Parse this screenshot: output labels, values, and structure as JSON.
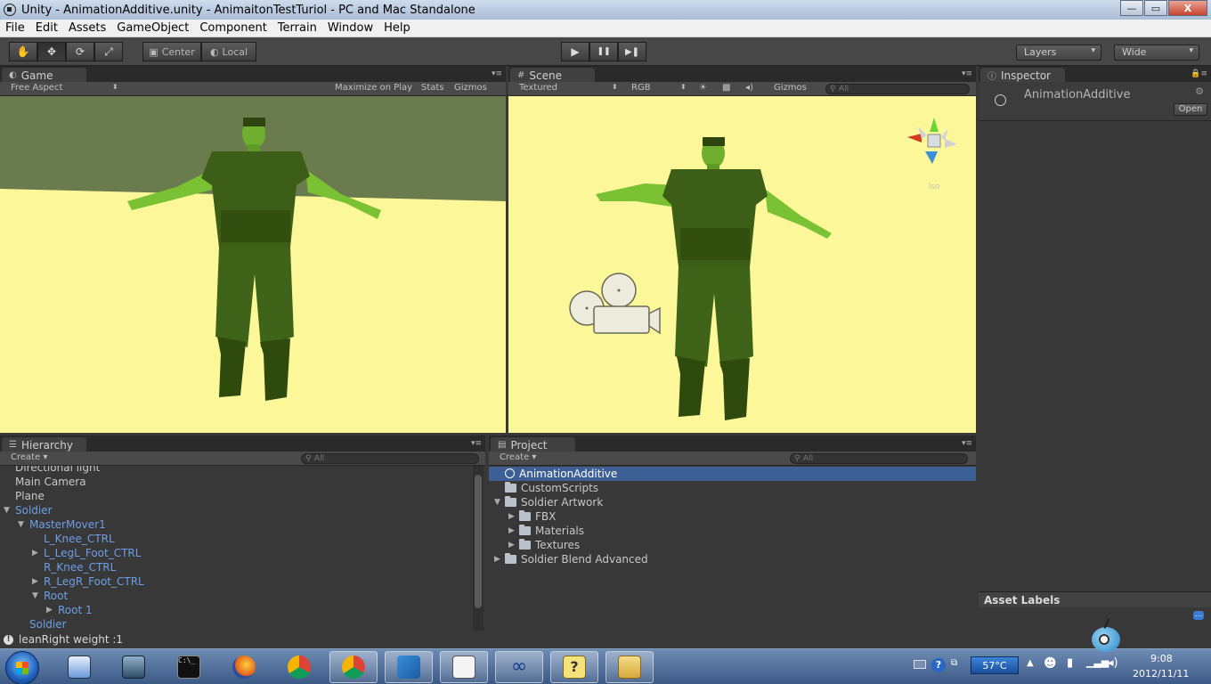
{
  "window": {
    "title": "Unity - AnimationAdditive.unity - AnimaitonTestTuriol - PC and Mac Standalone",
    "controls": {
      "minimize": "—",
      "maximize": "▭",
      "close": "X"
    }
  },
  "menu": [
    "File",
    "Edit",
    "Assets",
    "GameObject",
    "Component",
    "Terrain",
    "Window",
    "Help"
  ],
  "toolbar": {
    "tools": [
      "hand-icon",
      "move-icon",
      "rotate-icon",
      "scale-icon"
    ],
    "pivot_mode": "Center",
    "pivot_rotation": "Local",
    "play": "▶",
    "pause": "❚❚",
    "step": "▶❚",
    "layers": "Layers",
    "layout": "Wide"
  },
  "game": {
    "tab": "Game",
    "aspect": "Free Aspect",
    "maximize": "Maximize on Play",
    "stats": "Stats",
    "gizmos": "Gizmos"
  },
  "scene": {
    "tab": "Scene",
    "render_mode": "Textured",
    "channel": "RGB",
    "gizmos": "Gizmos",
    "search_placeholder": "All",
    "gizmo_label": "Iso"
  },
  "inspector": {
    "tab": "Inspector",
    "asset_name": "AnimationAdditive",
    "open_button": "Open",
    "asset_labels": "Asset Labels"
  },
  "hierarchy": {
    "tab": "Hierarchy",
    "create": "Create",
    "search_placeholder": "All",
    "items": [
      {
        "label": "Directional light",
        "indent": 0,
        "blue": false,
        "arrow": ""
      },
      {
        "label": "Main Camera",
        "indent": 0,
        "blue": false,
        "arrow": ""
      },
      {
        "label": "Plane",
        "indent": 0,
        "blue": false,
        "arrow": ""
      },
      {
        "label": "Soldier",
        "indent": 0,
        "blue": true,
        "arrow": "▼"
      },
      {
        "label": "MasterMover1",
        "indent": 1,
        "blue": true,
        "arrow": "▼"
      },
      {
        "label": "L_Knee_CTRL",
        "indent": 2,
        "blue": true,
        "arrow": ""
      },
      {
        "label": "L_LegL_Foot_CTRL",
        "indent": 2,
        "blue": true,
        "arrow": "▶"
      },
      {
        "label": "R_Knee_CTRL",
        "indent": 2,
        "blue": true,
        "arrow": ""
      },
      {
        "label": "R_LegR_Foot_CTRL",
        "indent": 2,
        "blue": true,
        "arrow": "▶"
      },
      {
        "label": "Root",
        "indent": 2,
        "blue": true,
        "arrow": "▼"
      },
      {
        "label": "Root 1",
        "indent": 3,
        "blue": true,
        "arrow": "▶"
      },
      {
        "label": "Soldier",
        "indent": 1,
        "blue": true,
        "arrow": ""
      }
    ]
  },
  "project": {
    "tab": "Project",
    "create": "Create",
    "search_placeholder": "All",
    "items": [
      {
        "label": "AnimationAdditive",
        "indent": 0,
        "arrow": "",
        "selected": true,
        "kind": "unity"
      },
      {
        "label": "CustomScripts",
        "indent": 0,
        "arrow": "",
        "selected": false,
        "kind": "folder"
      },
      {
        "label": "Soldier Artwork",
        "indent": 0,
        "arrow": "▼",
        "selected": false,
        "kind": "folder"
      },
      {
        "label": "FBX",
        "indent": 1,
        "arrow": "▶",
        "selected": false,
        "kind": "folder"
      },
      {
        "label": "Materials",
        "indent": 1,
        "arrow": "▶",
        "selected": false,
        "kind": "folder"
      },
      {
        "label": "Textures",
        "indent": 1,
        "arrow": "▶",
        "selected": false,
        "kind": "folder"
      },
      {
        "label": "Soldier Blend Advanced",
        "indent": 0,
        "arrow": "▶",
        "selected": false,
        "kind": "folder"
      }
    ]
  },
  "status": {
    "message": "leanRight weight :1"
  },
  "taskbar": {
    "temperature": "57°C",
    "time": "9:08",
    "date": "2012/11/11",
    "apps": [
      "task-manager-icon",
      "monitor-icon",
      "cmd-icon",
      "firefox-icon",
      "chrome-icon",
      "chrome-alt-icon",
      "editor-icon",
      "document-icon",
      "infinity-icon",
      "help-icon",
      "explorer-icon"
    ]
  },
  "colors": {
    "sky_game": "#6a7b4d",
    "ground": "#fcf89a",
    "soldier_dark": "#3d5e16",
    "soldier_skin": "#7ac234",
    "selection": "#3e5f96"
  }
}
